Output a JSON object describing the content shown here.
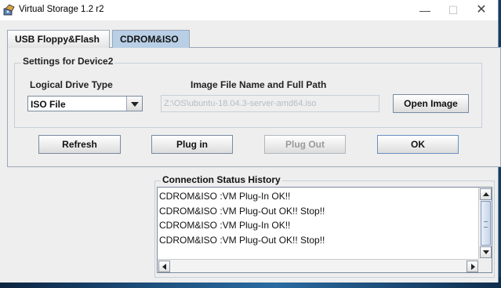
{
  "window": {
    "title": "Virtual Storage 1.2 r2",
    "minimize_glyph": "—",
    "maximize_glyph": "☐",
    "close_glyph": "✕"
  },
  "tabs": [
    {
      "label": "USB Floppy&Flash",
      "active": false
    },
    {
      "label": "CDROM&ISO",
      "active": true
    }
  ],
  "settings": {
    "group_title": "Settings for Device2",
    "drive_type_label": "Logical Drive Type",
    "drive_type_value": "ISO File",
    "image_path_label": "Image File Name and Full Path",
    "image_path_value": "Z:\\OS\\ubuntu-18.04.3-server-amd64.iso",
    "open_image_label": "Open Image"
  },
  "actions": {
    "refresh": "Refresh",
    "plug_in": "Plug in",
    "plug_out": "Plug Out",
    "ok": "OK"
  },
  "status": {
    "title": "Connection Status History",
    "lines": [
      "CDROM&ISO :VM Plug-In OK!!",
      "CDROM&ISO :VM Plug-Out OK!! Stop!!",
      "CDROM&ISO :VM Plug-In OK!!",
      "CDROM&ISO :VM Plug-Out OK!! Stop!!"
    ]
  },
  "colors": {
    "active_tab": "#b8cfe5",
    "window_bg": "#eeeeee",
    "desktop": "#1b3a5c"
  }
}
